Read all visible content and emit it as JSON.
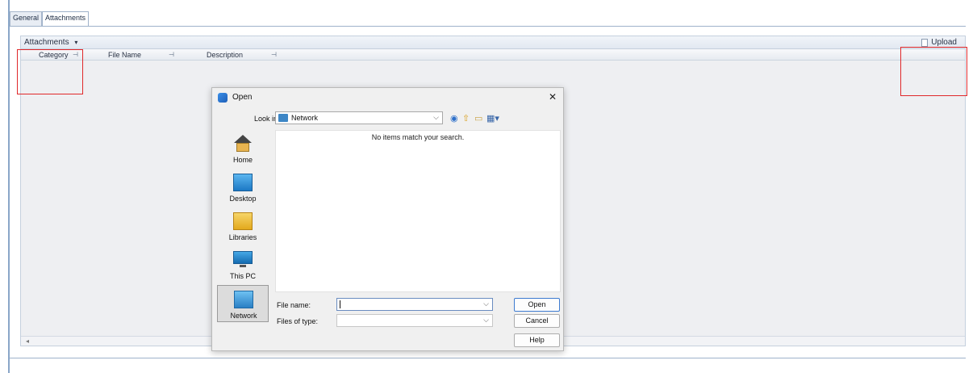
{
  "tabs": [
    {
      "label": "General"
    },
    {
      "label": "Attachments"
    }
  ],
  "panel": {
    "title": "Attachments",
    "title_caret": "▾",
    "upload_label": "Upload",
    "columns": [
      {
        "label": "Category"
      },
      {
        "label": "File Name"
      },
      {
        "label": "Description"
      }
    ],
    "pin_glyph": "⊣"
  },
  "dialog": {
    "title": "Open",
    "close_glyph": "✕",
    "look_in_label": "Look in:",
    "look_in_value": "Network",
    "empty_message": "No items match your search.",
    "places": [
      {
        "label": "Home",
        "icon": "home-icon"
      },
      {
        "label": "Desktop",
        "icon": "desktop-icon"
      },
      {
        "label": "Libraries",
        "icon": "libraries-icon"
      },
      {
        "label": "This PC",
        "icon": "this-pc-icon"
      },
      {
        "label": "Network",
        "icon": "network-icon",
        "selected": true
      }
    ],
    "file_name_label": "File name:",
    "file_name_value": "",
    "files_of_type_label": "Files of type:",
    "files_of_type_value": "",
    "open_button": "Open",
    "cancel_button": "Cancel",
    "help_button": "Help"
  },
  "colors": {
    "annotation_red": "#e0282a",
    "accent_blue": "#3d7bd0"
  }
}
